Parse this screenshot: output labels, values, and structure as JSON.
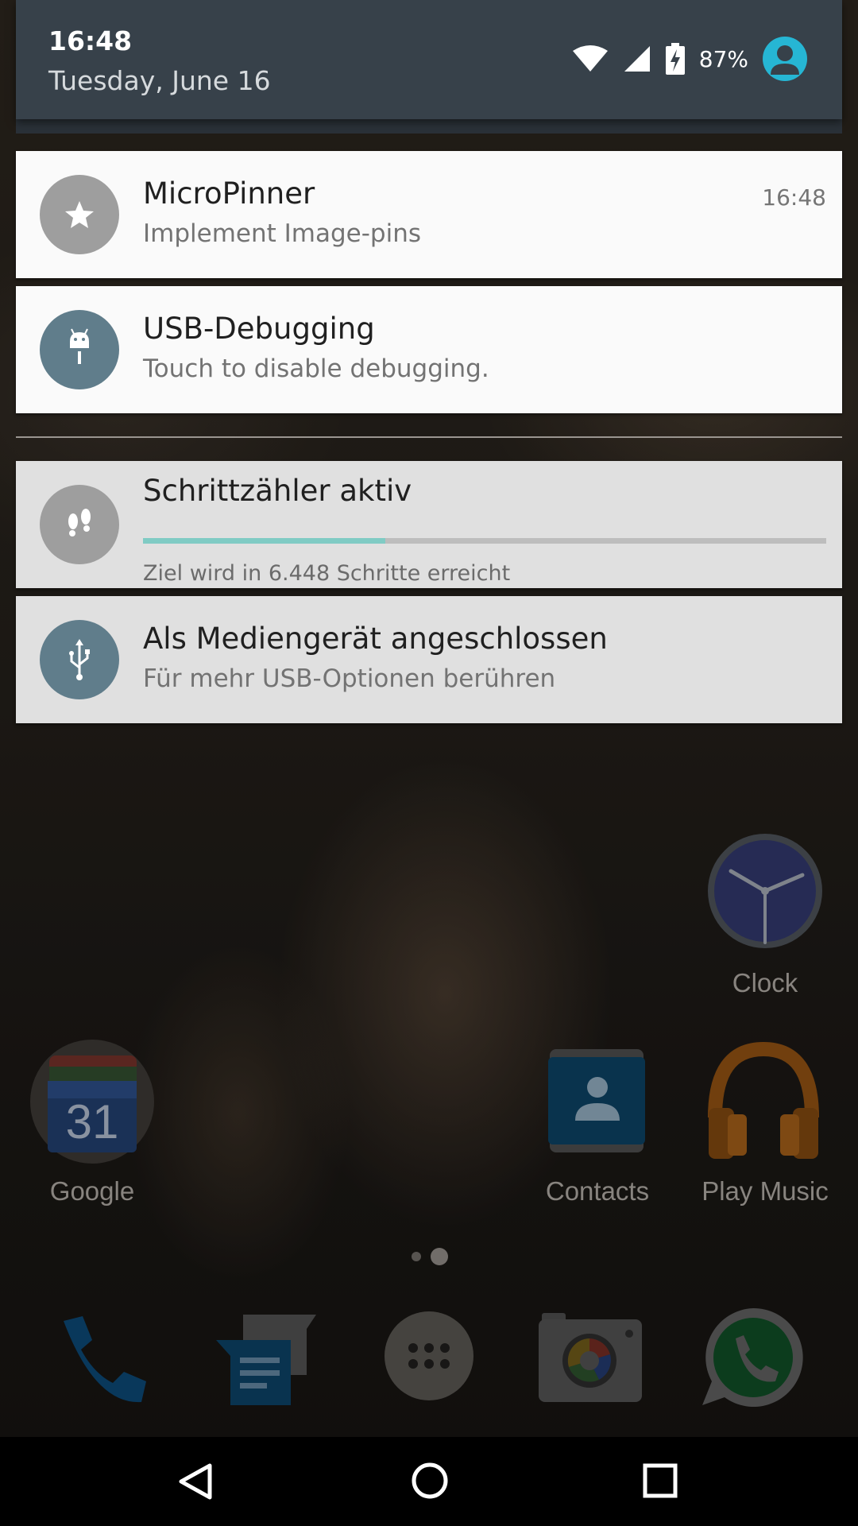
{
  "status": {
    "time": "16:48",
    "date": "Tuesday, June 16",
    "battery": "87%"
  },
  "notifications": [
    {
      "title": "MicroPinner",
      "text": "Implement Image-pins",
      "time": "16:48",
      "icon": "star-icon"
    },
    {
      "title": "USB-Debugging",
      "text": "Touch to disable debugging.",
      "icon": "android-debug-icon"
    },
    {
      "title": "Schrittzähler aktiv",
      "text": "Ziel wird in 6.448 Schritte erreicht",
      "progress": 0.355,
      "icon": "footprints-icon"
    },
    {
      "title": "Als Mediengerät angeschlossen",
      "text": "Für mehr USB-Optionen berühren",
      "icon": "usb-icon"
    }
  ],
  "home_apps": [
    {
      "label": "Clock",
      "icon": "clock-icon"
    },
    {
      "label": "Google",
      "icon": "calendar-folder-icon",
      "calendar_day": "31"
    },
    {
      "label": "Contacts",
      "icon": "contacts-icon"
    },
    {
      "label": "Play Music",
      "icon": "headphones-icon"
    }
  ],
  "dock": [
    "phone-icon",
    "messenger-icon",
    "app-drawer-icon",
    "camera-icon",
    "whatsapp-icon"
  ],
  "nav": [
    "back-icon",
    "home-icon",
    "recents-icon"
  ],
  "colors": {
    "header": "#37414a",
    "card_light": "#fafafa",
    "card_grey": "#e0e0e0",
    "icon_grey": "#9e9e9e",
    "icon_bluegrey": "#607d8b",
    "progress": "#80cbc4",
    "avatar": "#26b6d4"
  }
}
